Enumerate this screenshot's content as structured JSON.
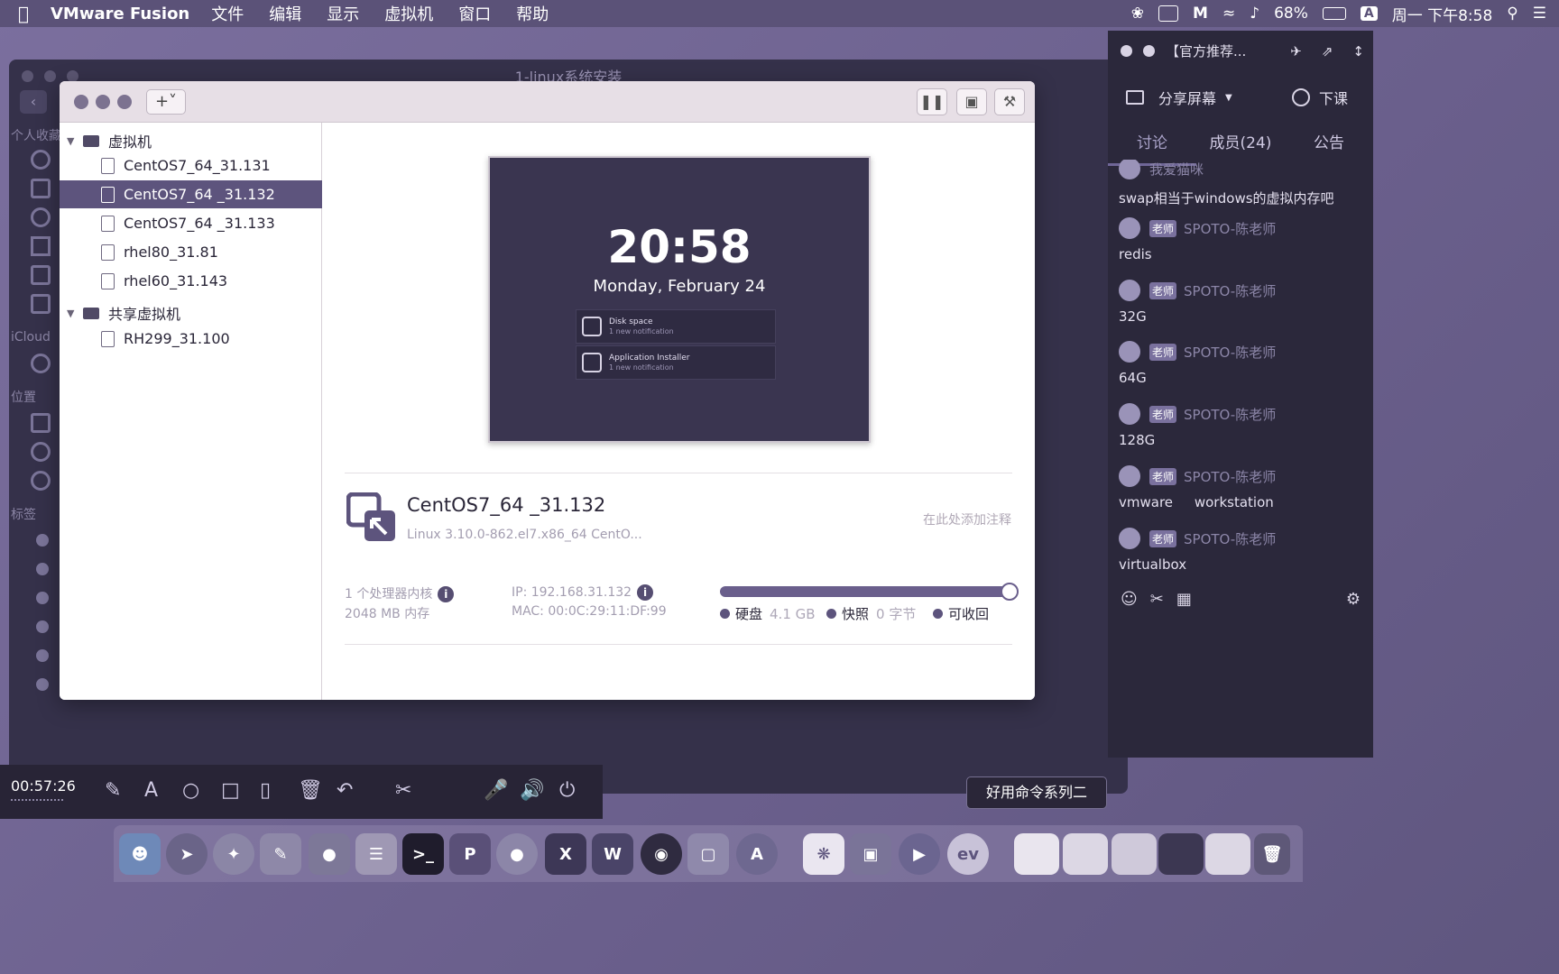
{
  "menubar": {
    "app": "VMware Fusion",
    "items": [
      "文件",
      "编辑",
      "显示",
      "虚拟机",
      "窗口",
      "帮助"
    ],
    "battery": "68%",
    "input": "A",
    "clock": "周一 下午8:58"
  },
  "bg_window": {
    "title": "1-linux系统安装",
    "sections": [
      "个人收藏",
      "iCloud",
      "位置",
      "标签"
    ]
  },
  "library": {
    "groups": [
      {
        "label": "虚拟机",
        "items": [
          "CentOS7_64_31.131",
          "CentOS7_64 _31.132",
          "CentOS7_64 _31.133",
          "rhel80_31.81",
          "rhel60_31.143"
        ]
      },
      {
        "label": "共享虚拟机",
        "items": [
          "RH299_31.100"
        ]
      }
    ],
    "selected_index": 1
  },
  "detail": {
    "screen": {
      "time": "20:58",
      "date": "Monday, February 24",
      "notifications": [
        {
          "title": "Disk space",
          "sub": "1 new notification"
        },
        {
          "title": "Application Installer",
          "sub": "1 new notification"
        }
      ]
    },
    "vm_name": "CentOS7_64 _31.132",
    "os": "Linux 3.10.0-862.el7.x86_64 CentO...",
    "annotation": "在此处添加注释",
    "cpu": "1 个处理器内核",
    "memory": "2048 MB 内存",
    "ip": "IP: 192.168.31.132",
    "mac": "MAC: 00:0C:29:11:DF:99",
    "storage": {
      "disk_label": "硬盘",
      "disk_value": "4.1 GB",
      "snapshot_label": "快照",
      "snapshot_value": "0 字节",
      "reclaim_label": "可收回"
    }
  },
  "chat": {
    "title": "【官方推荐...",
    "share_screen": "分享屏幕",
    "end_class": "下课",
    "tabs": [
      "讨论",
      "成员(24)",
      "公告"
    ],
    "active_tab": 0,
    "partial_sender": "我爱猫咪",
    "messages": [
      {
        "sender": "",
        "badge": "",
        "text": "swap相当于windows的虚拟内存吧"
      },
      {
        "sender": "SPOTO-陈老师",
        "badge": "老师",
        "text": "redis"
      },
      {
        "sender": "SPOTO-陈老师",
        "badge": "老师",
        "text": "32G"
      },
      {
        "sender": "SPOTO-陈老师",
        "badge": "老师",
        "text": "64G"
      },
      {
        "sender": "SPOTO-陈老师",
        "badge": "老师",
        "text": "128G"
      },
      {
        "sender": "SPOTO-陈老师",
        "badge": "老师",
        "text": "vmware     workstation"
      },
      {
        "sender": "SPOTO-陈老师",
        "badge": "老师",
        "text": "virtualbox"
      }
    ]
  },
  "recorder": {
    "elapsed": "00:57:26"
  },
  "tooltip": "好用命令系列二",
  "dock_labels": [
    "P",
    "X",
    "W"
  ],
  "colors": {
    "accent": "#5d547d",
    "menubar": "#5b5278",
    "chat_bg": "#2b283b"
  }
}
